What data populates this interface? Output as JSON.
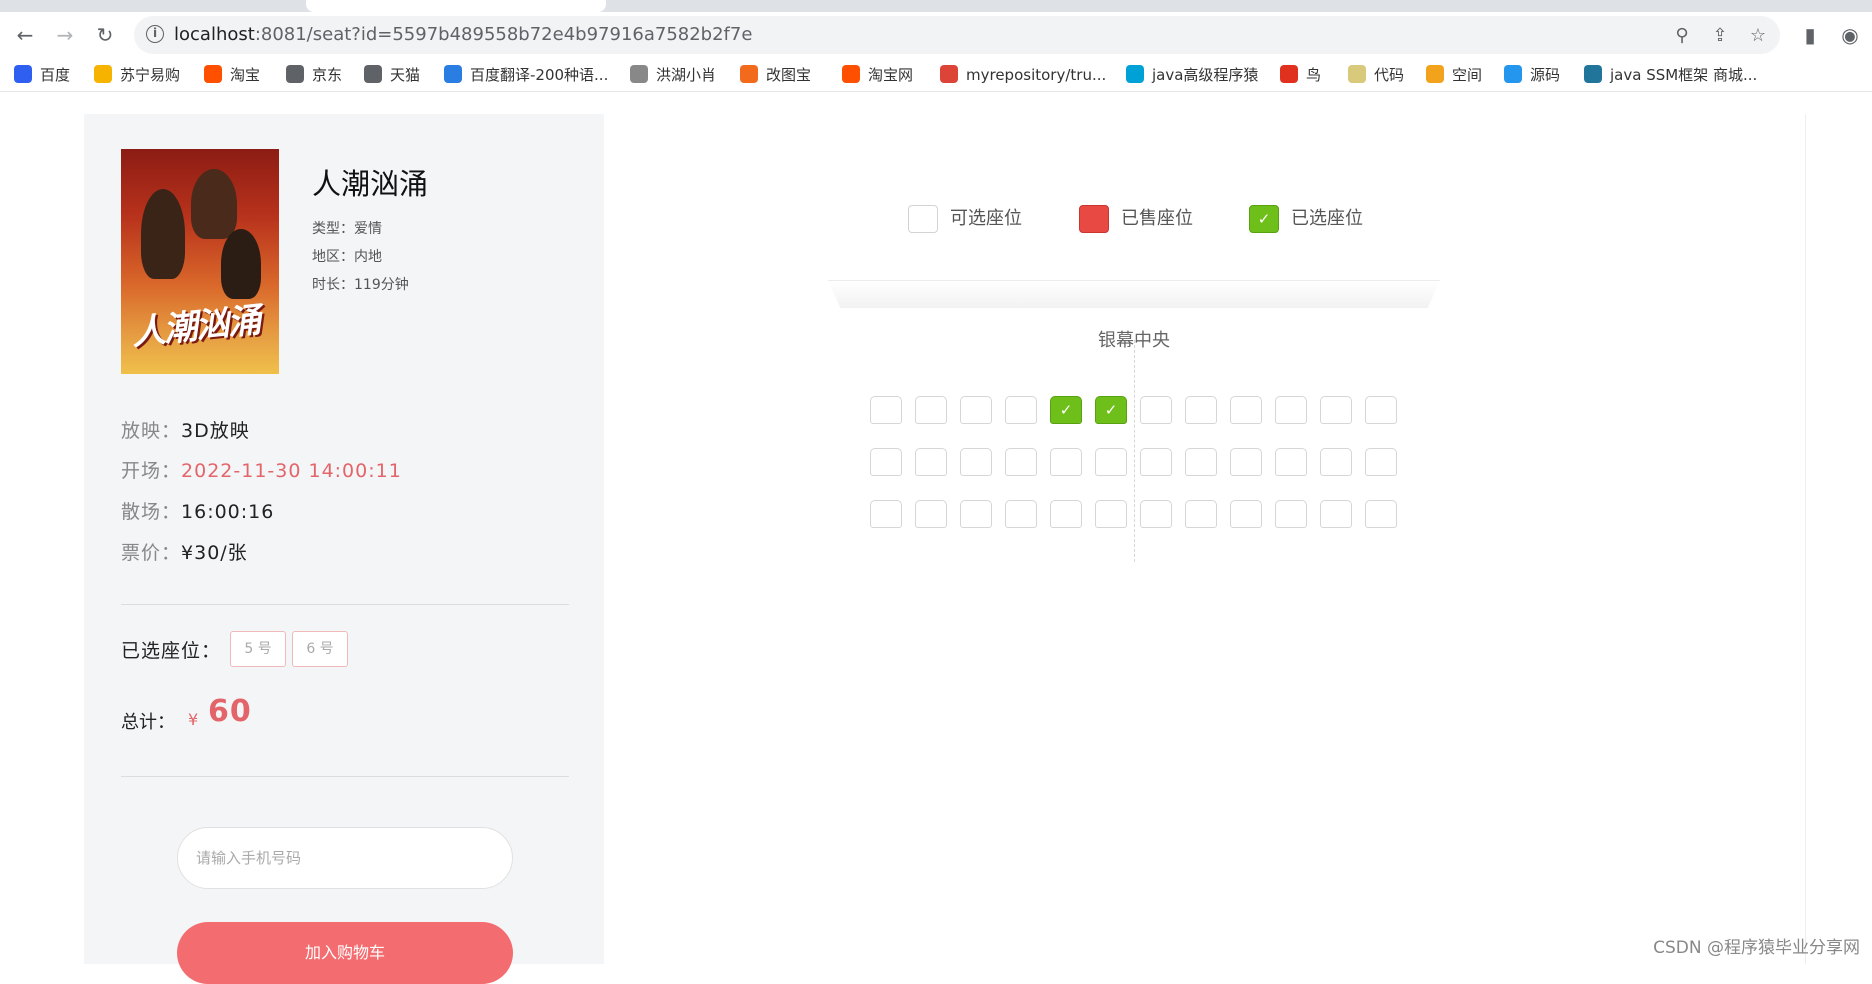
{
  "browser": {
    "url_host": "localhost",
    "url_rest": ":8081/seat?id=5597b489558b72e4b97916a7582b2f7e",
    "bookmarks": [
      {
        "label": "百度",
        "icon": "baidu-icon",
        "color": "#2f5ff0"
      },
      {
        "label": "苏宁易购",
        "icon": "suning-icon",
        "color": "#f6b400"
      },
      {
        "label": "淘宝",
        "icon": "taobao-icon",
        "color": "#ff5000"
      },
      {
        "label": "京东",
        "icon": "globe-icon",
        "color": "#5f6368"
      },
      {
        "label": "天猫",
        "icon": "globe-icon",
        "color": "#5f6368"
      },
      {
        "label": "百度翻译-200种语...",
        "icon": "translate-icon",
        "color": "#2a7de1"
      },
      {
        "label": "洪湖小肖",
        "icon": "bird-icon",
        "color": "#888888"
      },
      {
        "label": "改图宝",
        "icon": "image-icon",
        "color": "#f26b1d"
      },
      {
        "label": "淘宝网",
        "icon": "taobao-icon",
        "color": "#ff5000"
      },
      {
        "label": "myrepository/tru...",
        "icon": "chrome-icon",
        "color": "#db4437"
      },
      {
        "label": "java高级程序猿",
        "icon": "bilibili-icon",
        "color": "#00a1d6"
      },
      {
        "label": "鸟",
        "icon": "bird-icon",
        "color": "#e0301e"
      },
      {
        "label": "代码",
        "icon": "moon-icon",
        "color": "#d9c97a"
      },
      {
        "label": "空间",
        "icon": "qzone-icon",
        "color": "#f3a31b"
      },
      {
        "label": "源码",
        "icon": "docker-icon",
        "color": "#2496ed"
      },
      {
        "label": "java SSM框架 商城...",
        "icon": "wordpress-icon",
        "color": "#21759b"
      }
    ]
  },
  "movie": {
    "title": "人潮汹涌",
    "genre": "类型：爱情",
    "region": "地区：内地",
    "duration": "时长：119分钟",
    "poster_text": "人潮汹涌"
  },
  "details": {
    "format_label": "放映：",
    "format_value": "3D放映",
    "start_label": "开场：",
    "start_value": "2022-11-30 14:00:11",
    "end_label": "散场：",
    "end_value": "16:00:16",
    "price_label": "票价：",
    "price_value": "¥30/张"
  },
  "selection": {
    "label": "已选座位：",
    "seats": [
      "5 号",
      "6 号"
    ],
    "total_label": "总计：",
    "currency": "¥",
    "total": "60"
  },
  "form": {
    "phone_placeholder": "请输入手机号码",
    "cart_button": "加入购物车"
  },
  "legend": {
    "available": "可选座位",
    "sold": "已售座位",
    "selected": "已选座位"
  },
  "hall": {
    "screen_label": "银幕中央",
    "rows": 3,
    "cols": 12,
    "selected_seats": [
      [
        0,
        4
      ],
      [
        0,
        5
      ]
    ]
  },
  "colors": {
    "accent": "#e3656a",
    "button": "#f36c6f",
    "selected_seat": "#6fbf1a",
    "sold_seat": "#e84a43"
  },
  "watermark": "CSDN @程序猿毕业分享网"
}
